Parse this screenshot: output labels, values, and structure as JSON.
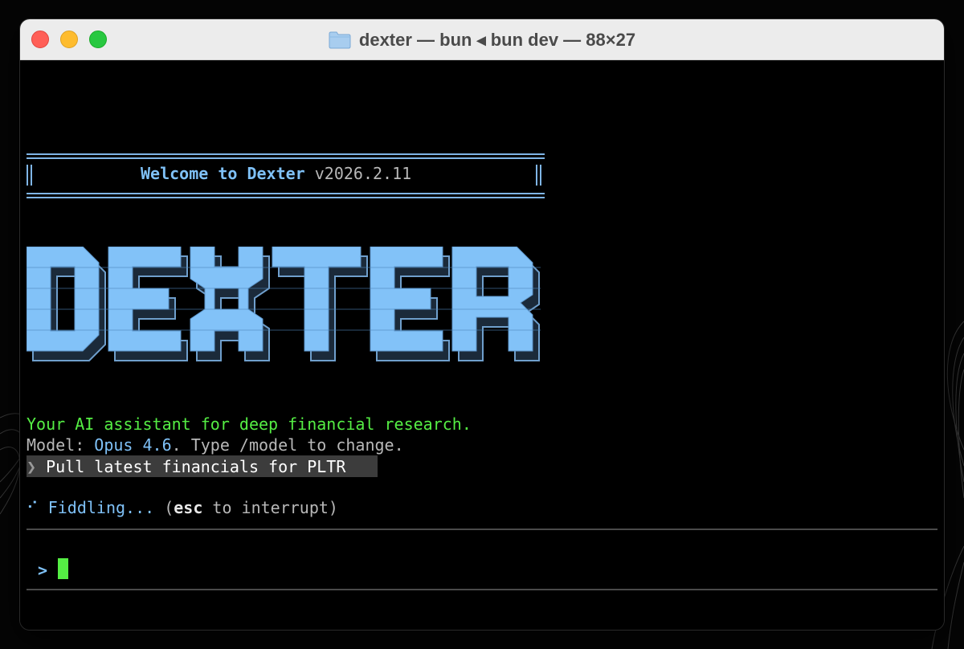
{
  "window": {
    "title": "dexter — bun ◂ bun dev — 88×27",
    "title_icon": "folder-icon"
  },
  "welcome": {
    "label": "Welcome to Dexter",
    "version": " v2026.2.11"
  },
  "logo": {
    "text": "DEXTER"
  },
  "tagline": "Your AI assistant for deep financial research.",
  "model_line": {
    "prefix": "Model: ",
    "model_name": "Opus 4.6",
    "suffix": ". Type /model to change."
  },
  "history": {
    "chevron": "❯",
    "query": " Pull latest financials for PLTR "
  },
  "status": {
    "spinner": "⠊",
    "verb": " Fiddling...",
    "open": " (",
    "key": "esc",
    "rest": " to interrupt)"
  },
  "input": {
    "prompt_symbol": ">"
  },
  "colors": {
    "accent_blue": "#7fc1f7",
    "green": "#55ee44",
    "text_gray": "#b8b8b8"
  }
}
